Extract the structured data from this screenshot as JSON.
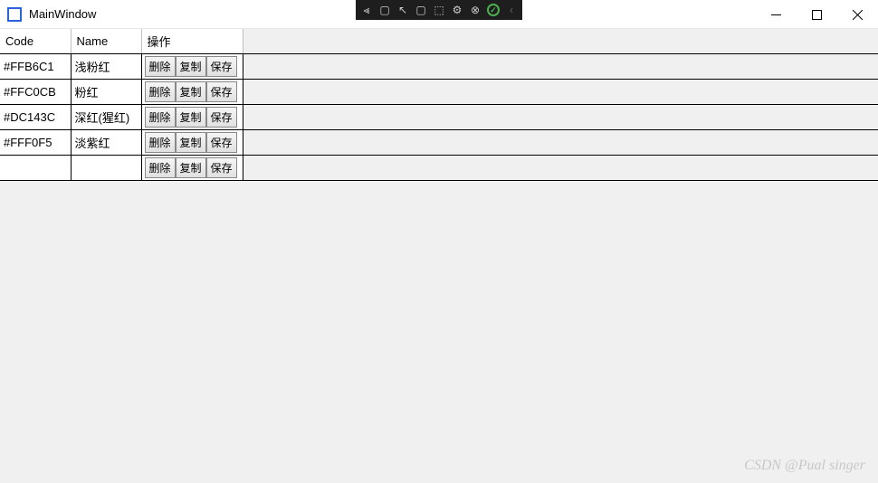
{
  "window": {
    "title": "MainWindow"
  },
  "table": {
    "headers": {
      "code": "Code",
      "name": "Name",
      "action": "操作"
    },
    "rows": [
      {
        "code": "#FFB6C1",
        "name": "浅粉红"
      },
      {
        "code": "#FFC0CB",
        "name": "粉红"
      },
      {
        "code": "#DC143C",
        "name": "深红(猩红)"
      },
      {
        "code": "#FFF0F5",
        "name": "淡紫红"
      },
      {
        "code": "",
        "name": ""
      }
    ],
    "buttons": {
      "delete": "删除",
      "copy": "复制",
      "save": "保存"
    }
  },
  "watermark": "CSDN @Pual singer"
}
